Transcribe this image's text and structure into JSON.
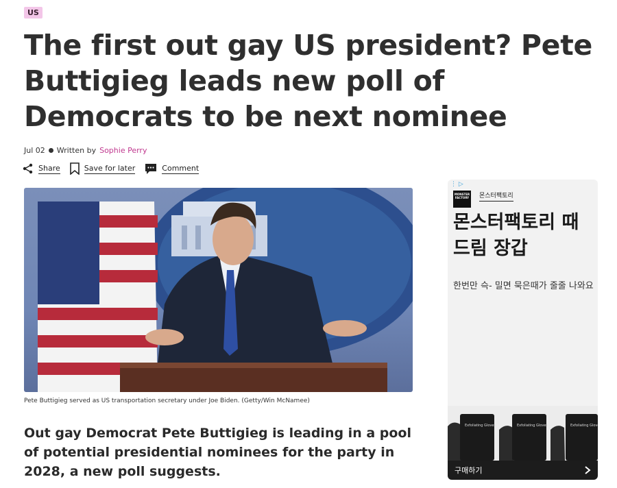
{
  "article": {
    "tag": "US",
    "headline": "The first out gay US president? Pete Buttigieg leads new poll of Democrats to be next nominee",
    "date": "Jul 02",
    "written_by": "Written by",
    "author": "Sophie Perry",
    "actions": {
      "share": "Share",
      "save": "Save for later",
      "comment": "Comment"
    },
    "image_caption": "Pete Buttigieg served as US transportation secretary under Joe Biden. (Getty/Win McNamee)",
    "lede": "Out gay Democrat Pete Buttigieg is leading in a pool of potential presidential nominees for the party in 2028, a new poll suggests."
  },
  "ad": {
    "logo_text": "MONSTER FACTORY",
    "brand": "몬스터팩토리",
    "title": "몬스터팩토리 때드림 장갑",
    "body": "한번만 슥- 밀면 묵은때가 줄줄 나와요",
    "product_label": "Exfoliating Gloves",
    "cta": "구매하기",
    "colors": {
      "accent": "#3aa0d8",
      "cta_bg": "#1c1c1c"
    }
  },
  "colors": {
    "author": "#c0398f",
    "tag_bg": "#f3c6e8"
  }
}
